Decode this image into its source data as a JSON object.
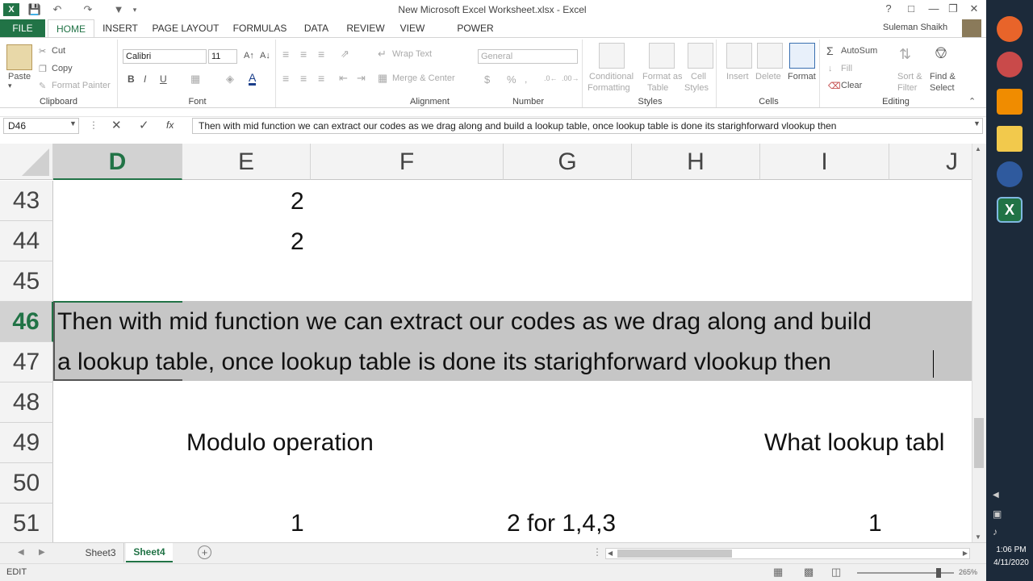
{
  "window": {
    "title": "New Microsoft Excel Worksheet.xlsx - Excel",
    "user": "Suleman Shaikh"
  },
  "ribbon_tabs": [
    "FILE",
    "HOME",
    "INSERT",
    "PAGE LAYOUT",
    "FORMULAS",
    "DATA",
    "REVIEW",
    "VIEW",
    "POWER QUERY"
  ],
  "clipboard": {
    "paste": "Paste",
    "cut": "Cut",
    "copy": "Copy",
    "format_painter": "Format Painter",
    "label": "Clipboard"
  },
  "font": {
    "name": "Calibri",
    "size": "11",
    "bold": "B",
    "italic": "I",
    "underline": "U",
    "label": "Font"
  },
  "alignment": {
    "wrap": "Wrap Text",
    "merge": "Merge & Center",
    "label": "Alignment"
  },
  "number": {
    "format": "General",
    "currency": "$",
    "percent": "%",
    "label": "Number"
  },
  "styles": {
    "conditional": "Conditional",
    "conditional2": "Formatting",
    "format_as": "Format as",
    "format_as2": "Table",
    "cell": "Cell",
    "cell2": "Styles",
    "label": "Styles"
  },
  "cells": {
    "insert": "Insert",
    "delete": "Delete",
    "format": "Format",
    "label": "Cells"
  },
  "editing": {
    "autosum": "AutoSum",
    "fill": "Fill",
    "clear": "Clear",
    "sort": "Sort &",
    "sort2": "Filter",
    "find": "Find &",
    "find2": "Select",
    "label": "Editing"
  },
  "formula_bar": {
    "name_box": "D46",
    "fx": "fx",
    "content": "Then with mid function we can extract our codes as we drag along and build a lookup table, once lookup table is done its starighforward vlookup then"
  },
  "columns": [
    "D",
    "E",
    "F",
    "G",
    "H",
    "I",
    "J"
  ],
  "rows": [
    "43",
    "44",
    "45",
    "46",
    "47",
    "48",
    "49",
    "50",
    "51"
  ],
  "cells_data": {
    "e43": "2",
    "e44": "2",
    "d46": "Then with mid function we can extract our codes as we drag along and build",
    "d47": "a lookup table, once lookup table is done its starighforward vlookup then",
    "e49": "Modulo operation",
    "i49": "What lookup tabl",
    "e51": "1",
    "g51": "2 for 1,4,3",
    "i51": "1"
  },
  "sheets": [
    "Sheet3",
    "Sheet4"
  ],
  "active_sheet": "Sheet4",
  "status": {
    "mode": "EDIT",
    "zoom": "265%"
  },
  "clock": {
    "time": "1:06 PM",
    "date": "4/11/2020"
  },
  "colors": {
    "excel_green": "#217346",
    "selection": "#c6c6c6",
    "header_active": "#d2d2d2"
  }
}
